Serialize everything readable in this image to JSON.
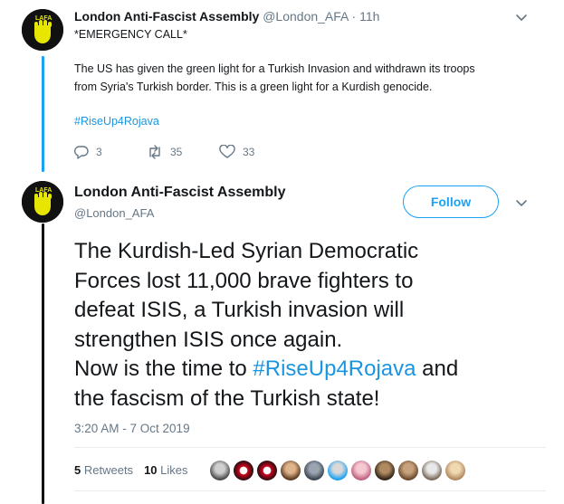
{
  "tweet1": {
    "name": "London Anti-Fascist Assembly",
    "handle": "@London_AFA",
    "separator": "·",
    "time": "11h",
    "line_emergency": "*EMERGENCY CALL*",
    "line_1": "The US has given the green light for a Turkish Invasion and withdrawn its troops",
    "line_2": "from Syria's Turkish border. This is a green light for a Kurdish genocide.",
    "hashtag": "#RiseUp4Rojava",
    "replies": "3",
    "retweets": "35",
    "likes": "33"
  },
  "tweet2": {
    "name": "London Anti-Fascist Assembly",
    "handle": "@London_AFA",
    "follow_label": "Follow",
    "text_line1": "The Kurdish-Led Syrian Democratic",
    "text_line2": "Forces lost 11,000 brave fighters to",
    "text_line3": "defeat ISIS, a Turkish invasion will",
    "text_line4": "strengthen ISIS once again.",
    "text_line5_pre": "Now is the time to ",
    "text_line5_hashtag": "#RiseUp4Rojava",
    "text_line5_post": " and",
    "text_line6": "the fascism of the Turkish state!",
    "timestamp": "3:20 AM - 7 Oct 2019",
    "retweets_count": "5",
    "retweets_label": "Retweets",
    "likes_count": "10",
    "likes_label": "Likes"
  },
  "avatar_text": "LAFA",
  "colors": {
    "accent": "#1da1f2",
    "hashtag": "#1b95e0",
    "muted": "#657786",
    "avatar_yellow": "#e6e600"
  },
  "icons": {
    "reply": "reply-icon",
    "retweet": "retweet-icon",
    "like": "heart-icon",
    "more": "chevron-down-icon"
  }
}
